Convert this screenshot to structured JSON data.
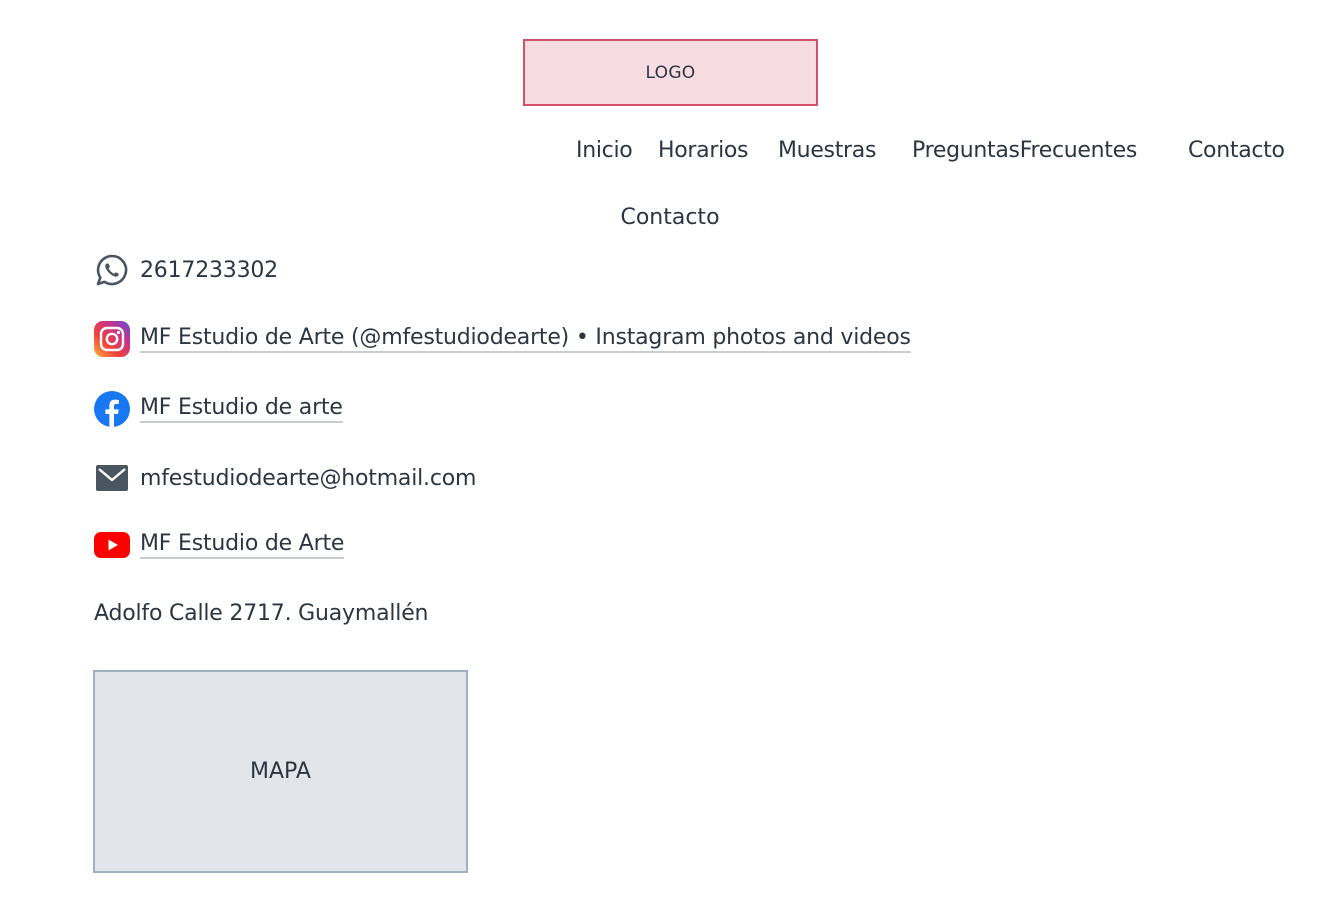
{
  "header": {
    "logo_label": "LOGO"
  },
  "nav": {
    "items": [
      "Inicio",
      "Horarios",
      "Muestras",
      "PreguntasFrecuentes",
      "Contacto"
    ]
  },
  "contact": {
    "title": "Contacto",
    "whatsapp": {
      "icon": "whatsapp-icon",
      "text": "2617233302"
    },
    "instagram": {
      "icon": "instagram-icon",
      "text": "MF Estudio de Arte (@mfestudiodearte) • Instagram photos and videos"
    },
    "facebook": {
      "icon": "facebook-icon",
      "text": "MF Estudio de arte"
    },
    "email": {
      "icon": "mail-icon",
      "text": "mfestudiodearte@hotmail.com"
    },
    "youtube": {
      "icon": "youtube-icon",
      "text": "MF Estudio de Arte"
    },
    "address": "Adolfo Calle 2717. Guaymallén",
    "map_label": "MAPA"
  },
  "colors": {
    "text": "#2c3642",
    "logo_bg": "#f7dce1",
    "logo_border": "#d4516b",
    "map_bg": "#e2e6ea",
    "map_border": "#9fb0c2",
    "facebook": "#1877f2",
    "youtube": "#ff0000"
  }
}
